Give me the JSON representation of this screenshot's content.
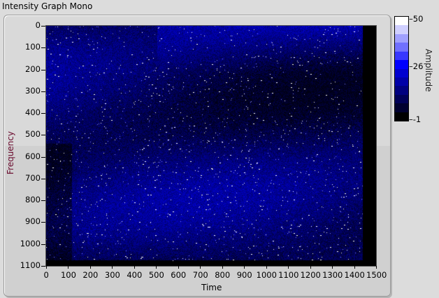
{
  "title": "Intensity Graph Mono",
  "chart_data": {
    "type": "heatmap",
    "title": "Intensity Graph Mono",
    "xlabel": "Time",
    "ylabel": "Frequency",
    "zlabel": "Amplitude",
    "xlim": [
      0,
      1500
    ],
    "ylim": [
      1100,
      0
    ],
    "zlim": [
      -1,
      50
    ],
    "x_ticks": [
      0,
      100,
      200,
      300,
      400,
      500,
      600,
      700,
      800,
      900,
      1000,
      1100,
      1200,
      1300,
      1400,
      1500
    ],
    "y_ticks": [
      0,
      100,
      200,
      300,
      400,
      500,
      600,
      700,
      800,
      900,
      1000,
      1100
    ],
    "z_ticks": [
      50,
      26,
      -1
    ],
    "data_extent": {
      "x": [
        0,
        1440
      ],
      "y": [
        0,
        1075
      ]
    },
    "colormap": [
      "#ffffff",
      "#d0d0ff",
      "#a0a0ff",
      "#7070ff",
      "#3838ff",
      "#0000ff",
      "#0000d0",
      "#0000a8",
      "#000080",
      "#000058",
      "#000030",
      "#000000"
    ]
  }
}
